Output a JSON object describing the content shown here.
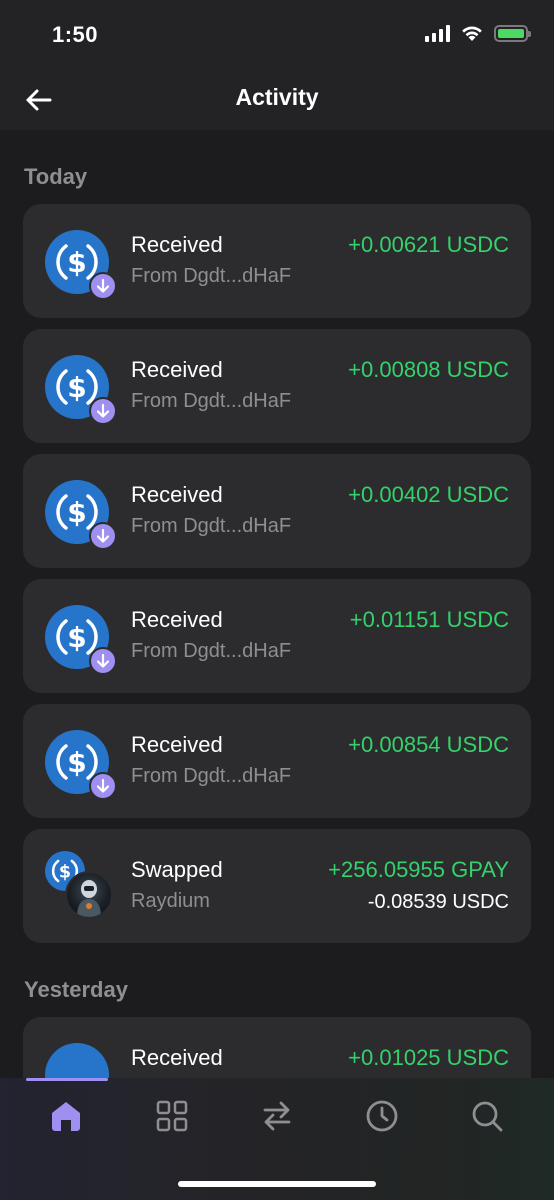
{
  "status": {
    "time": "1:50"
  },
  "header": {
    "title": "Activity"
  },
  "sections": {
    "today": "Today",
    "yesterday": "Yesterday"
  },
  "transactions": [
    {
      "title": "Received",
      "subtitle": "From Dgdt...dHaF",
      "amount": "+0.00621 USDC"
    },
    {
      "title": "Received",
      "subtitle": "From Dgdt...dHaF",
      "amount": "+0.00808 USDC"
    },
    {
      "title": "Received",
      "subtitle": "From Dgdt...dHaF",
      "amount": "+0.00402 USDC"
    },
    {
      "title": "Received",
      "subtitle": "From Dgdt...dHaF",
      "amount": "+0.01151 USDC"
    },
    {
      "title": "Received",
      "subtitle": "From Dgdt...dHaF",
      "amount": "+0.00854 USDC"
    },
    {
      "title": "Swapped",
      "subtitle": "Raydium",
      "amount": "+256.05955 GPAY",
      "amount2": "-0.08539 USDC"
    }
  ],
  "yesterday_transactions": [
    {
      "title": "Received",
      "amount": "+0.01025 USDC"
    }
  ],
  "tabs": [
    {
      "icon": "home-icon"
    },
    {
      "icon": "grid-icon"
    },
    {
      "icon": "swap-arrows-icon"
    },
    {
      "icon": "history-clock-icon"
    },
    {
      "icon": "search-icon"
    }
  ],
  "colors": {
    "background": "#1c1c1e",
    "card": "#2c2c2e",
    "positive": "#34d26a",
    "accent": "#9f8ff0",
    "usdc_blue": "#2775ca",
    "muted_text": "#8e8e93"
  }
}
